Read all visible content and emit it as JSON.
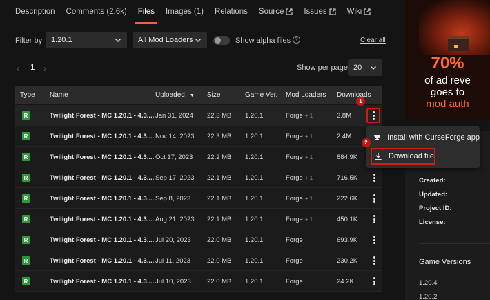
{
  "tabs": [
    {
      "label": "Description",
      "active": false,
      "external": false
    },
    {
      "label": "Comments (2.6k)",
      "active": false,
      "external": false
    },
    {
      "label": "Files",
      "active": true,
      "external": false
    },
    {
      "label": "Images (1)",
      "active": false,
      "external": false
    },
    {
      "label": "Relations",
      "active": false,
      "external": false
    },
    {
      "label": "Source",
      "active": false,
      "external": true
    },
    {
      "label": "Issues",
      "active": false,
      "external": true
    },
    {
      "label": "Wiki",
      "active": false,
      "external": true
    }
  ],
  "filters": {
    "label": "Filter by",
    "version_value": "1.20.1",
    "loader_value": "All Mod Loaders",
    "alpha_label": "Show alpha files",
    "alpha_enabled": false,
    "help_icon": "?",
    "clear_all": "Clear all"
  },
  "pagination": {
    "prev_icon": "‹",
    "current_page": "1",
    "next_icon": "›",
    "show_label": "Show per page",
    "per_page": "20"
  },
  "table": {
    "headers": {
      "type": "Type",
      "name": "Name",
      "uploaded": "Uploaded",
      "size": "Size",
      "game_ver": "Game Ver.",
      "mod_loaders": "Mod Loaders",
      "downloads": "Downloads"
    },
    "sort_icon": "▼",
    "type_badge": "R",
    "rows": [
      {
        "name": "Twilight Forest - MC 1.20.1 - 4.3....",
        "uploaded": "Jan 31, 2024",
        "size": "22.3 MB",
        "game_ver": "1.20.1",
        "loader": "Forge",
        "loader_extra": "+ 1",
        "downloads": "3.8M"
      },
      {
        "name": "Twilight Forest - MC 1.20.1 - 4.3....",
        "uploaded": "Nov 14, 2023",
        "size": "22.3 MB",
        "game_ver": "1.20.1",
        "loader": "Forge",
        "loader_extra": "+ 1",
        "downloads": "2.4M"
      },
      {
        "name": "Twilight Forest - MC 1.20.1 - 4.3....",
        "uploaded": "Oct 17, 2023",
        "size": "22.2 MB",
        "game_ver": "1.20.1",
        "loader": "Forge",
        "loader_extra": "+ 1",
        "downloads": "884.9K"
      },
      {
        "name": "Twilight Forest - MC 1.20.1 - 4.3....",
        "uploaded": "Sep 17, 2023",
        "size": "22.1 MB",
        "game_ver": "1.20.1",
        "loader": "Forge",
        "loader_extra": "+ 1",
        "downloads": "716.5K"
      },
      {
        "name": "Twilight Forest - MC 1.20.1 - 4.3....",
        "uploaded": "Sep 8, 2023",
        "size": "22.1 MB",
        "game_ver": "1.20.1",
        "loader": "Forge",
        "loader_extra": "+ 1",
        "downloads": "222.6K"
      },
      {
        "name": "Twilight Forest - MC 1.20.1 - 4.3....",
        "uploaded": "Aug 21, 2023",
        "size": "22.1 MB",
        "game_ver": "1.20.1",
        "loader": "Forge",
        "loader_extra": "+ 1",
        "downloads": "450.1K"
      },
      {
        "name": "Twilight Forest - MC 1.20.1 - 4.3....",
        "uploaded": "Jul 20, 2023",
        "size": "22.0 MB",
        "game_ver": "1.20.1",
        "loader": "Forge",
        "loader_extra": "",
        "downloads": "693.9K"
      },
      {
        "name": "Twilight Forest - MC 1.20.1 - 4.3....",
        "uploaded": "Jul 11, 2023",
        "size": "22.0 MB",
        "game_ver": "1.20.1",
        "loader": "Forge",
        "loader_extra": "",
        "downloads": "230.2K"
      },
      {
        "name": "Twilight Forest - MC 1.20.1 - 4.3....",
        "uploaded": "Jul 10, 2023",
        "size": "22.0 MB",
        "game_ver": "1.20.1",
        "loader": "Forge",
        "loader_extra": "",
        "downloads": "24.2K"
      }
    ]
  },
  "menu": {
    "install_label": "Install with CurseForge app",
    "download_label": "Download file"
  },
  "steps": {
    "one": "1",
    "two": "2"
  },
  "ad": {
    "line1": "70%",
    "line2": "of ad reve",
    "line3": "goes to",
    "line4": "mod auth"
  },
  "details": {
    "created": "Created:",
    "updated": "Updated:",
    "project_id": "Project ID:",
    "license": "License:",
    "game_versions_title": "Game Versions",
    "game_versions": [
      "1.20.4",
      "1.20.2"
    ]
  },
  "colors": {
    "accent": "#f16436",
    "highlight": "#d11a1a",
    "badge_green": "#2d9a3a",
    "background": "#141414"
  }
}
